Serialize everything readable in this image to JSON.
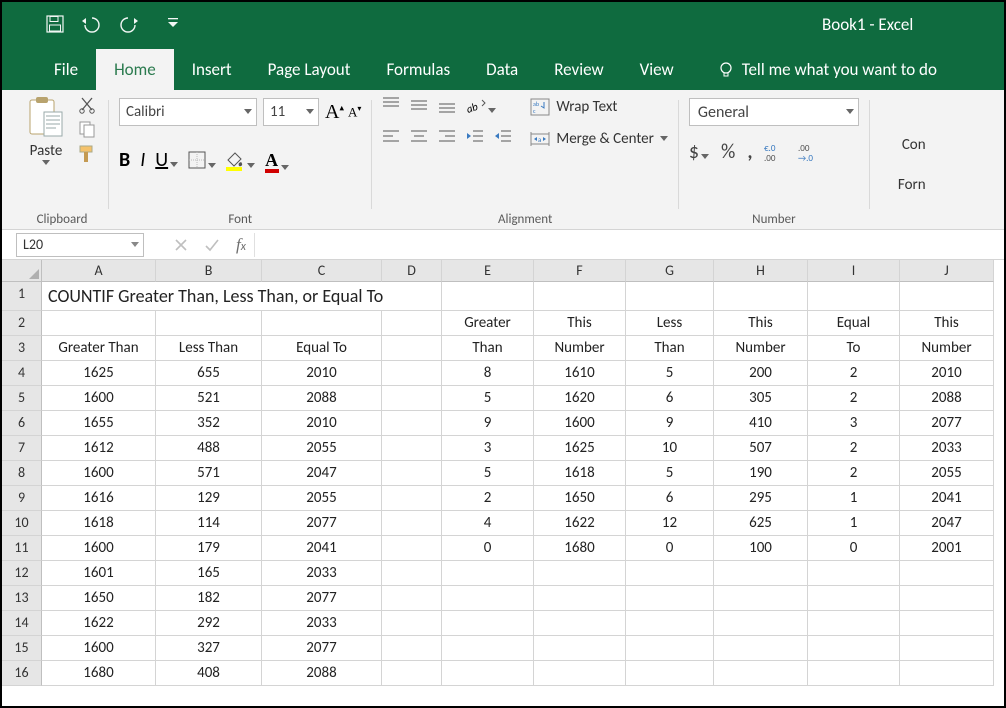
{
  "app": {
    "title": "Book1 - Excel"
  },
  "tabs": [
    "File",
    "Home",
    "Insert",
    "Page Layout",
    "Formulas",
    "Data",
    "Review",
    "View"
  ],
  "active_tab": "Home",
  "tell_me": "Tell me what you want to do",
  "ribbon": {
    "paste_label": "Paste",
    "clipboard_group": "Clipboard",
    "font_group": "Font",
    "alignment_group": "Alignment",
    "number_group": "Number",
    "font_name": "Calibri",
    "font_size": "11",
    "wrap_label": "Wrap Text",
    "merge_label": "Merge & Center",
    "number_format": "General",
    "conditional_label": "Con",
    "format_label": "Forn"
  },
  "namebox": "L20",
  "columns": [
    "A",
    "B",
    "C",
    "D",
    "E",
    "F",
    "G",
    "H",
    "I",
    "J"
  ],
  "rows_hdr": [
    "1",
    "2",
    "3",
    "4",
    "5",
    "6",
    "7",
    "8",
    "9",
    "10",
    "11",
    "12",
    "13",
    "14",
    "15",
    "16"
  ],
  "chart_data": {
    "type": "table",
    "title": "COUNTIF Greater Than, Less Than, or Equal To",
    "headers_row2": [
      "",
      "",
      "",
      "",
      "Greater",
      "This",
      "Less",
      "This",
      "Equal",
      "This"
    ],
    "headers_row3": [
      "Greater Than",
      "Less Than",
      "Equal To",
      "",
      "Than",
      "Number",
      "Than",
      "Number",
      "To",
      "Number"
    ],
    "rows": [
      [
        "1625",
        "655",
        "2010",
        "",
        "8",
        "1610",
        "5",
        "200",
        "2",
        "2010"
      ],
      [
        "1600",
        "521",
        "2088",
        "",
        "5",
        "1620",
        "6",
        "305",
        "2",
        "2088"
      ],
      [
        "1655",
        "352",
        "2010",
        "",
        "9",
        "1600",
        "9",
        "410",
        "3",
        "2077"
      ],
      [
        "1612",
        "488",
        "2055",
        "",
        "3",
        "1625",
        "10",
        "507",
        "2",
        "2033"
      ],
      [
        "1600",
        "571",
        "2047",
        "",
        "5",
        "1618",
        "5",
        "190",
        "2",
        "2055"
      ],
      [
        "1616",
        "129",
        "2055",
        "",
        "2",
        "1650",
        "6",
        "295",
        "1",
        "2041"
      ],
      [
        "1618",
        "114",
        "2077",
        "",
        "4",
        "1622",
        "12",
        "625",
        "1",
        "2047"
      ],
      [
        "1600",
        "179",
        "2041",
        "",
        "0",
        "1680",
        "0",
        "100",
        "0",
        "2001"
      ],
      [
        "1601",
        "165",
        "2033",
        "",
        "",
        "",
        "",
        "",
        "",
        ""
      ],
      [
        "1650",
        "182",
        "2077",
        "",
        "",
        "",
        "",
        "",
        "",
        ""
      ],
      [
        "1622",
        "292",
        "2033",
        "",
        "",
        "",
        "",
        "",
        "",
        ""
      ],
      [
        "1600",
        "327",
        "2077",
        "",
        "",
        "",
        "",
        "",
        "",
        ""
      ],
      [
        "1680",
        "408",
        "2088",
        "",
        "",
        "",
        "",
        "",
        "",
        ""
      ]
    ]
  }
}
